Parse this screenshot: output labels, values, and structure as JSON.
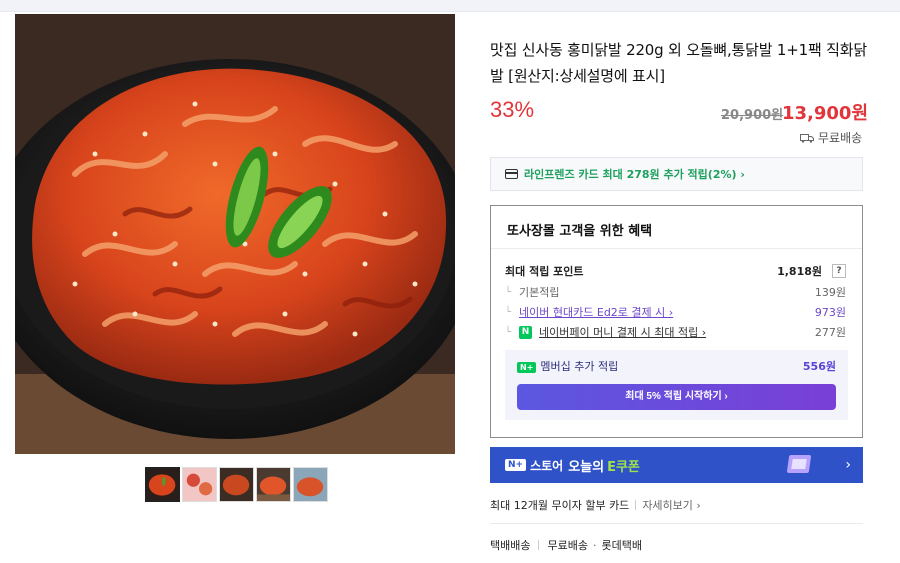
{
  "product": {
    "title": "맛집 신사동 홍미닭발 220g 외 오돌뼈,통닭발 1+1팩 직화닭발 [원산지:상세설명에 표시]",
    "discount": "33%",
    "original_price": "20,900원",
    "sale_price": "13,900원",
    "shipping": "무료배송"
  },
  "card_promo": {
    "text": "라인프렌즈 카드 최대 278원 추가 적립(2%) ›"
  },
  "benefits": {
    "title": "또사장몰 고객을 위한 혜택",
    "max_points_label": "최대 적립 포인트",
    "max_points_value": "1,818원",
    "help": "?",
    "rows": [
      {
        "label": "기본적립",
        "value": "139원"
      },
      {
        "label": "네이버 현대카드 Ed2로 결제 시 ›",
        "value": "973원"
      },
      {
        "label": "네이버페이 머니 결제 시 최대 적립 ›",
        "value": "277원"
      }
    ],
    "membership_label": "멤버십 추가 적립",
    "membership_value": "556원",
    "start_button": "최대 5% 적립 시작하기 ›",
    "npay_badge": "N",
    "nplus_badge": "N+"
  },
  "coupon_banner": {
    "badge": "N+",
    "store": "스토어",
    "today": "오늘의",
    "e_coupon": "E쿠폰",
    "chevron": "›"
  },
  "installment": {
    "text": "최대 12개월 무이자 할부 카드",
    "more": "자세히보기 ›"
  },
  "delivery": {
    "type": "택배배송",
    "fee": "무료배송",
    "courier": "롯데택배"
  },
  "colors": {
    "accent_red": "#e2353b",
    "naver_green": "#03c75a",
    "purple": "#6c47c9",
    "coupon_blue": "#2f52c9"
  }
}
